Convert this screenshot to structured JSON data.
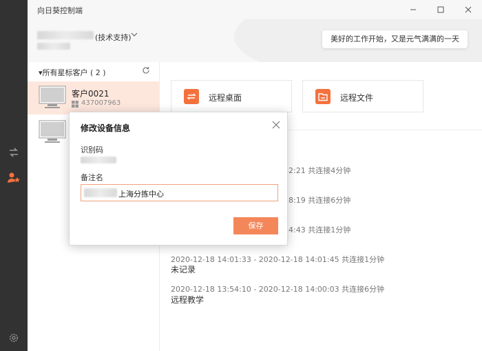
{
  "app": {
    "title": "向日葵控制端"
  },
  "header": {
    "account_suffix": "(技术支持)",
    "greeting": "美好的工作开始，又是元气满满的一天"
  },
  "sidebar": {
    "group_title": "▾所有星标客户 ( 2 )",
    "devices": [
      {
        "name": "客户0021",
        "id": "437007963",
        "selected": true
      },
      {
        "name": "",
        "id": "",
        "selected": false
      }
    ]
  },
  "main": {
    "tiles": [
      {
        "label": "远程桌面",
        "icon": "remote-desktop-icon"
      },
      {
        "label": "远程文件",
        "icon": "folder-icon"
      }
    ],
    "history": [
      {
        "time": "42:21 共连接4分钟",
        "note": ""
      },
      {
        "time": "18:19 共连接6分钟",
        "note": ""
      },
      {
        "time": "14:43 共连接1分钟",
        "note": ""
      },
      {
        "time": "2020-12-18 14:01:33 - 2020-12-18 14:01:45 共连接1分钟",
        "note": "未记录"
      },
      {
        "time": "2020-12-18 13:54:10 - 2020-12-18 14:00:03 共连接6分钟",
        "note": "远程教学"
      }
    ]
  },
  "dialog": {
    "title": "修改设备信息",
    "id_label": "识别码",
    "remark_label": "备注名",
    "remark_value": "上海分拣中心",
    "save_label": "保存"
  },
  "colors": {
    "accent": "#f4713d",
    "rail": "#323232",
    "selected_row": "#fde7dd"
  }
}
